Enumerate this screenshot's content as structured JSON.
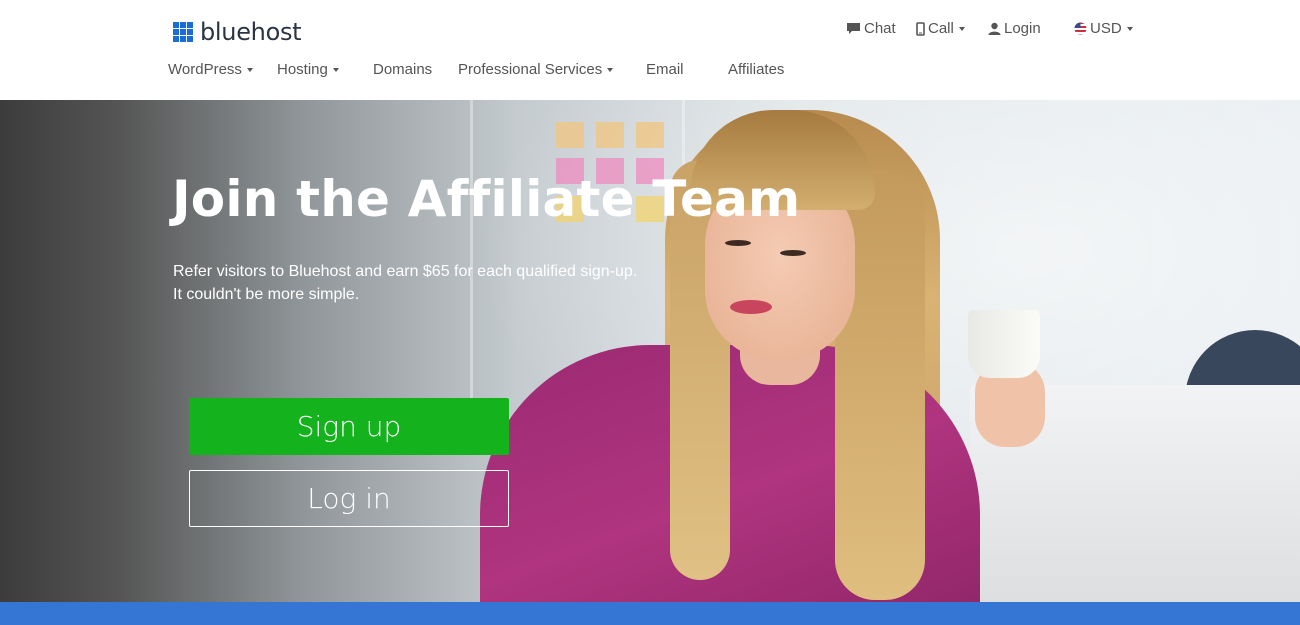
{
  "brand": {
    "name": "bluehost",
    "color": "#1b6cdb"
  },
  "utility_nav": {
    "chat": {
      "label": "Chat",
      "icon": "chat-bubble-icon"
    },
    "call": {
      "label": "Call",
      "icon": "mobile-phone-icon"
    },
    "login": {
      "label": "Login",
      "icon": "user-icon"
    },
    "currency": {
      "label": "USD",
      "icon": "us-flag-icon"
    }
  },
  "main_nav": {
    "items": [
      {
        "label": "WordPress",
        "has_dropdown": true
      },
      {
        "label": "Hosting",
        "has_dropdown": true
      },
      {
        "label": "Domains",
        "has_dropdown": false
      },
      {
        "label": "Professional Services",
        "has_dropdown": true
      },
      {
        "label": "Email",
        "has_dropdown": false
      },
      {
        "label": "Affiliates",
        "has_dropdown": false
      }
    ]
  },
  "hero": {
    "title": "Join the Affiliate Team",
    "line1": "Refer visitors to Bluehost and earn $65 for each qualified sign-up.",
    "line2": "It couldn't be more simple.",
    "signup_label": "Sign up",
    "login_label": "Log in"
  },
  "colors": {
    "signup_button": "#14b21d",
    "bottom_bar": "#3575d3",
    "nav_text": "#555555"
  }
}
